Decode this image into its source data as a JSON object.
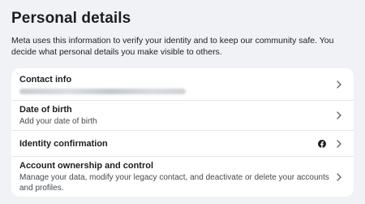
{
  "header": {
    "title": "Personal details",
    "description": "Meta uses this information to verify your identity and to keep our community safe. You decide what personal details you make visible to others."
  },
  "rows": [
    {
      "title": "Contact info",
      "subtitle": "",
      "value_obscured": true,
      "icon": "chevron-right-icon"
    },
    {
      "title": "Date of birth",
      "subtitle": "Add your date of birth",
      "icon": "chevron-right-icon"
    },
    {
      "title": "Identity confirmation",
      "subtitle": "",
      "badge_icon": "facebook-icon",
      "icon": "chevron-right-icon"
    },
    {
      "title": "Account ownership and control",
      "subtitle": "Manage your data, modify your legacy contact, and deactivate or delete your accounts and profiles.",
      "icon": "chevron-right-icon"
    }
  ],
  "colors": {
    "background": "#f0f2f5",
    "card": "#ffffff",
    "text_primary": "#1c1e21",
    "text_secondary": "#444950",
    "chevron": "#606770"
  }
}
